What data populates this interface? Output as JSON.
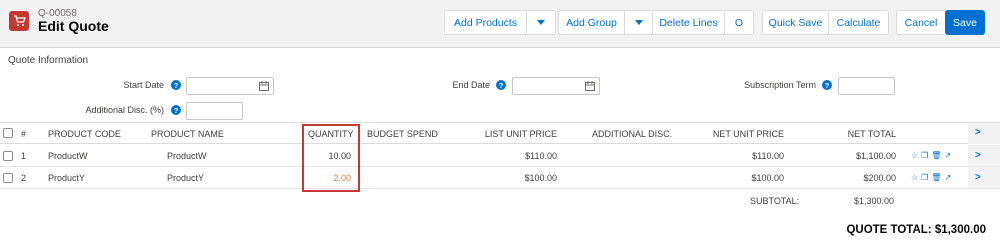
{
  "header": {
    "quote_id": "Q-00058",
    "title": "Edit Quote",
    "buttons": {
      "add_products": "Add Products",
      "add_group": "Add Group",
      "delete_lines": "Delete Lines",
      "circle_btn": "O",
      "quick_save": "Quick Save",
      "calculate": "Calculate",
      "cancel": "Cancel",
      "save": "Save"
    }
  },
  "quote_info": {
    "section_title": "Quote Information",
    "start_date_label": "Start Date",
    "end_date_label": "End Date",
    "subscription_term_label": "Subscription Term",
    "additional_disc_label": "Additional Disc. (%)",
    "start_date_value": "",
    "end_date_value": "",
    "subscription_term_value": "",
    "additional_disc_value": ""
  },
  "table": {
    "columns": {
      "num": "#",
      "product_code": "PRODUCT CODE",
      "product_name": "PRODUCT NAME",
      "quantity": "QUANTITY",
      "budget_spend": "BUDGET SPEND",
      "list_unit_price": "LIST UNIT PRICE",
      "additional_disc": "ADDITIONAL DISC.",
      "net_unit_price": "NET UNIT PRICE",
      "net_total": "NET TOTAL"
    },
    "rows": [
      {
        "num": "1",
        "product_code": "ProductW",
        "product_name": "ProductW",
        "quantity": "10.00",
        "budget_spend": "",
        "list_unit_price": "$110.00",
        "additional_disc": "",
        "net_unit_price": "$110.00",
        "net_total": "$1,100.00"
      },
      {
        "num": "2",
        "product_code": "ProductY",
        "product_name": "ProductY",
        "quantity": "2.00",
        "budget_spend": "",
        "list_unit_price": "$100.00",
        "additional_disc": "",
        "net_unit_price": "$100.00",
        "net_total": "$200.00"
      }
    ],
    "subtotal_label": "SUBTOTAL:",
    "subtotal_value": "$1,300.00",
    "quote_total": "QUOTE TOTAL: $1,300.00"
  },
  "colors": {
    "accent": "#0070d2",
    "brand_icon": "#c23934",
    "highlight": "#c23934",
    "edited_value": "#e8793a"
  },
  "icons": [
    "cart-icon",
    "dropdown-caret-icon",
    "help-icon",
    "calendar-icon",
    "star-icon",
    "copy-icon",
    "trash-icon",
    "trend-icon",
    "chevron-right-icon"
  ]
}
